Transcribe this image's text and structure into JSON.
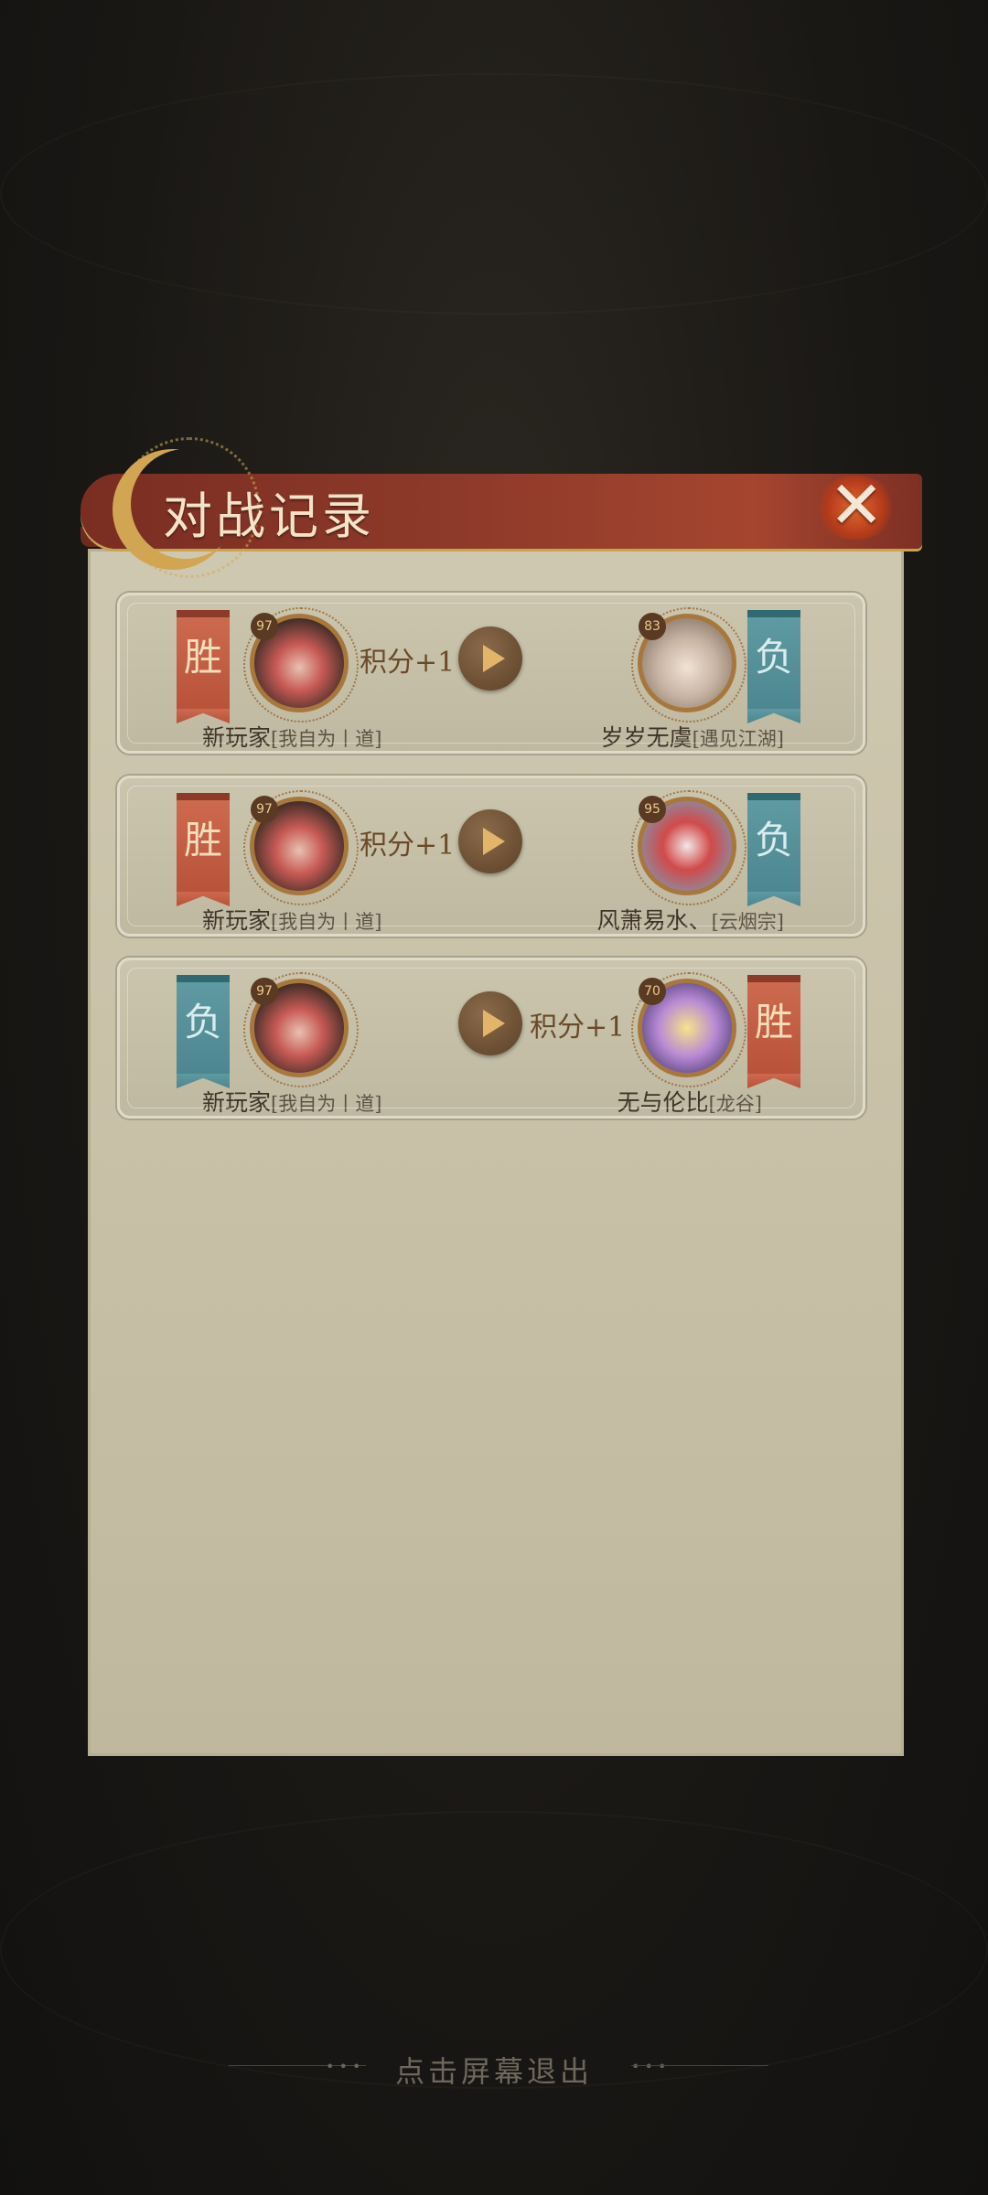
{
  "header": {
    "title": "对战记录"
  },
  "close_button": {
    "label": "✕"
  },
  "records": [
    {
      "left": {
        "result": "胜",
        "level": "97",
        "name": "新玩家",
        "tag": "[我自为丨道]"
      },
      "score_side": "left",
      "score_text": "积分+1",
      "right": {
        "result": "负",
        "level": "83",
        "name": "岁岁无虞",
        "tag": "[遇见江湖]"
      }
    },
    {
      "left": {
        "result": "胜",
        "level": "97",
        "name": "新玩家",
        "tag": "[我自为丨道]"
      },
      "score_side": "left",
      "score_text": "积分+1",
      "right": {
        "result": "负",
        "level": "95",
        "name": "风萧易水、",
        "tag": "[云烟宗]"
      }
    },
    {
      "left": {
        "result": "负",
        "level": "97",
        "name": "新玩家",
        "tag": "[我自为丨道]"
      },
      "score_side": "right",
      "score_text": "积分+1",
      "right": {
        "result": "胜",
        "level": "70",
        "name": "无与伦比",
        "tag": "[龙谷]"
      }
    }
  ],
  "footer": {
    "hint": "点击屏幕退出"
  },
  "colors": {
    "win": "#cc6a4f",
    "lose": "#5f9aa2",
    "panel": "#c7c0a7",
    "header": "#8e3a2a"
  }
}
